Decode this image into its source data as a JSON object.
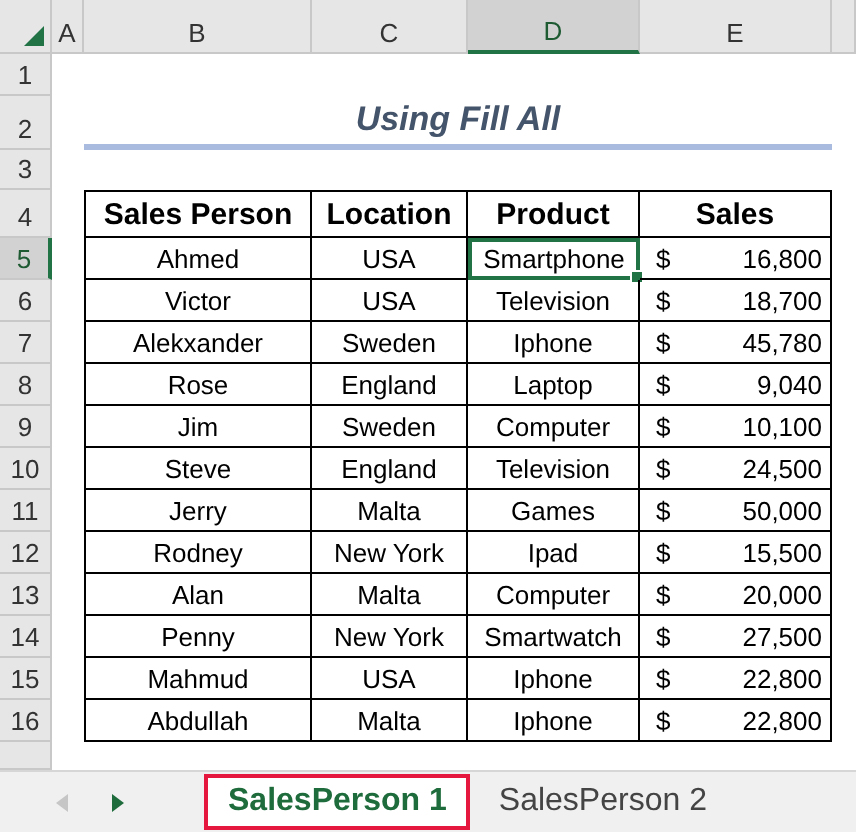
{
  "columns": [
    {
      "label": "A",
      "selected": false
    },
    {
      "label": "B",
      "selected": false
    },
    {
      "label": "C",
      "selected": false
    },
    {
      "label": "D",
      "selected": true
    },
    {
      "label": "E",
      "selected": false
    }
  ],
  "row_headers": [
    {
      "label": "1",
      "selected": false
    },
    {
      "label": "2",
      "selected": false
    },
    {
      "label": "3",
      "selected": false
    },
    {
      "label": "4",
      "selected": false
    },
    {
      "label": "5",
      "selected": true
    },
    {
      "label": "6",
      "selected": false
    },
    {
      "label": "7",
      "selected": false
    },
    {
      "label": "8",
      "selected": false
    },
    {
      "label": "9",
      "selected": false
    },
    {
      "label": "10",
      "selected": false
    },
    {
      "label": "11",
      "selected": false
    },
    {
      "label": "12",
      "selected": false
    },
    {
      "label": "13",
      "selected": false
    },
    {
      "label": "14",
      "selected": false
    },
    {
      "label": "15",
      "selected": false
    },
    {
      "label": "16",
      "selected": false
    }
  ],
  "title": "Using Fill All",
  "table": {
    "headers": [
      "Sales Person",
      "Location",
      "Product",
      "Sales"
    ],
    "rows": [
      {
        "sales_person": "Ahmed",
        "location": "USA",
        "product": "Smartphone",
        "currency": "$",
        "sales": "16,800",
        "selected": true
      },
      {
        "sales_person": "Victor",
        "location": "USA",
        "product": "Television",
        "currency": "$",
        "sales": "18,700",
        "selected": false
      },
      {
        "sales_person": "Alekxander",
        "location": "Sweden",
        "product": "Iphone",
        "currency": "$",
        "sales": "45,780",
        "selected": false
      },
      {
        "sales_person": "Rose",
        "location": "England",
        "product": "Laptop",
        "currency": "$",
        "sales": "9,040",
        "selected": false
      },
      {
        "sales_person": "Jim",
        "location": "Sweden",
        "product": "Computer",
        "currency": "$",
        "sales": "10,100",
        "selected": false
      },
      {
        "sales_person": "Steve",
        "location": "England",
        "product": "Television",
        "currency": "$",
        "sales": "24,500",
        "selected": false
      },
      {
        "sales_person": "Jerry",
        "location": "Malta",
        "product": "Games",
        "currency": "$",
        "sales": "50,000",
        "selected": false
      },
      {
        "sales_person": "Rodney",
        "location": "New York",
        "product": "Ipad",
        "currency": "$",
        "sales": "15,500",
        "selected": false
      },
      {
        "sales_person": "Alan",
        "location": "Malta",
        "product": "Computer",
        "currency": "$",
        "sales": "20,000",
        "selected": false
      },
      {
        "sales_person": "Penny",
        "location": "New York",
        "product": "Smartwatch",
        "currency": "$",
        "sales": "27,500",
        "selected": false
      },
      {
        "sales_person": "Mahmud",
        "location": "USA",
        "product": "Iphone",
        "currency": "$",
        "sales": "22,800",
        "selected": false
      },
      {
        "sales_person": "Abdullah",
        "location": "Malta",
        "product": "Iphone",
        "currency": "$",
        "sales": "22,800",
        "selected": false
      }
    ]
  },
  "sheet_tabs": [
    {
      "label": "SalesPerson 1",
      "selected": true
    },
    {
      "label": "SalesPerson 2",
      "selected": false
    }
  ]
}
